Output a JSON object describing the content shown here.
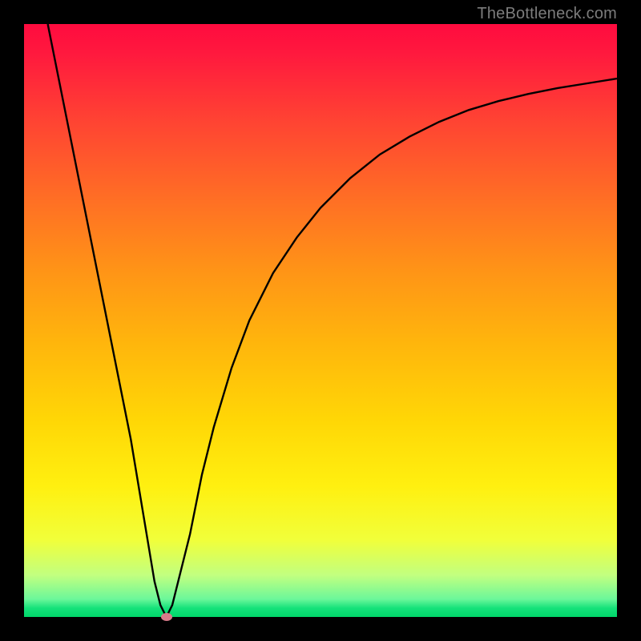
{
  "watermark": "TheBottleneck.com",
  "chart_data": {
    "type": "line",
    "title": "",
    "xlabel": "",
    "ylabel": "",
    "xlim": [
      0,
      100
    ],
    "ylim": [
      0,
      100
    ],
    "grid": false,
    "legend": false,
    "background_gradient": {
      "direction": "vertical",
      "stops": [
        {
          "pos": 0,
          "color": "#ff0b3f"
        },
        {
          "pos": 50,
          "color": "#ffb60c"
        },
        {
          "pos": 85,
          "color": "#f1ff3a"
        },
        {
          "pos": 100,
          "color": "#00d76a"
        }
      ]
    },
    "series": [
      {
        "name": "bottleneck-curve",
        "color": "#000000",
        "x": [
          4,
          6,
          8,
          10,
          12,
          14,
          16,
          18,
          20,
          21,
          22,
          23,
          24,
          25,
          26,
          28,
          30,
          32,
          35,
          38,
          42,
          46,
          50,
          55,
          60,
          65,
          70,
          75,
          80,
          85,
          90,
          95,
          100
        ],
        "y": [
          100,
          90,
          80,
          70,
          60,
          50,
          40,
          30,
          18,
          12,
          6,
          2,
          0,
          2,
          6,
          14,
          24,
          32,
          42,
          50,
          58,
          64,
          69,
          74,
          78,
          81,
          83.5,
          85.5,
          87,
          88.2,
          89.2,
          90,
          90.8
        ]
      }
    ],
    "marker": {
      "name": "current-config",
      "x": 24,
      "y": 0,
      "color": "#d97a8a"
    }
  }
}
